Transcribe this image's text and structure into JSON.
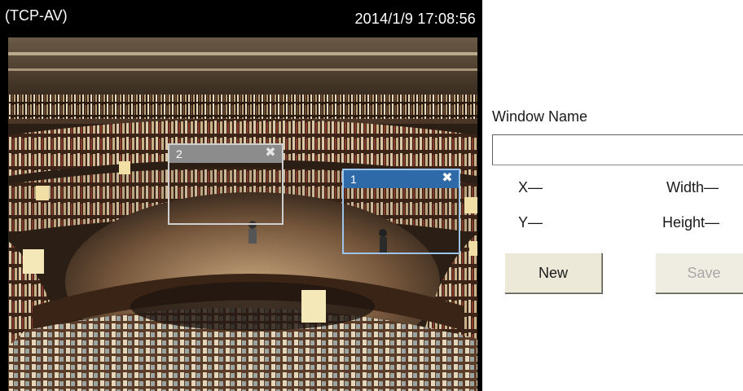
{
  "video": {
    "stream_label": "(TCP-AV)",
    "timestamp": "2014/1/9  17:08:56"
  },
  "motion_windows": [
    {
      "label": "1",
      "close_glyph": "✖",
      "title_color": "#2f6aa8",
      "border_color": "#9cc3ea"
    },
    {
      "label": "2",
      "close_glyph": "✖",
      "title_color": "#8c8c8c",
      "border_color": "#cfcfcf"
    }
  ],
  "settings": {
    "window_name_label": "Window Name",
    "window_name_value": "",
    "x_label": "X—",
    "y_label": "Y—",
    "width_label": "Width—",
    "height_label": "Height—",
    "new_button": "New",
    "save_button": "Save",
    "save_enabled": false
  }
}
